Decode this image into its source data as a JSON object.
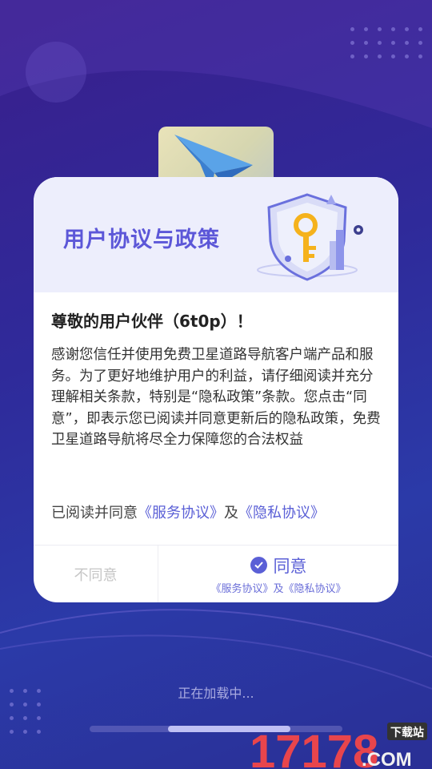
{
  "dialog": {
    "title": "用户协议与政策",
    "greeting": "尊敬的用户伙伴（6t0p）！",
    "body": "感谢您信任并使用免费卫星道路导航客户端产品和服务。为了更好地维护用户的利益，请仔细阅读并充分理解相关条款，特别是“隐私政策”条款。您点击“同意”，即表示您已阅读并同意更新后的隐私政策，免费卫星道路导航将尽全力保障您的合法权益",
    "agree_prefix": "已阅读并同意",
    "service_link": "《服务协议》",
    "and": "及",
    "privacy_link": "《隐私协议》",
    "disagree_label": "不同意",
    "agree_label": "同意",
    "agree_sub": "《服务协议》及《隐私协议》"
  },
  "loading": {
    "text": "正在加载中...",
    "progress": 0.7
  },
  "watermark": {
    "brand": "17178",
    "suffix": ".COM",
    "tag": "下载站"
  },
  "colors": {
    "accent": "#5a5fd6",
    "header_bg": "#edeefc",
    "background": "#2f2a9a"
  }
}
